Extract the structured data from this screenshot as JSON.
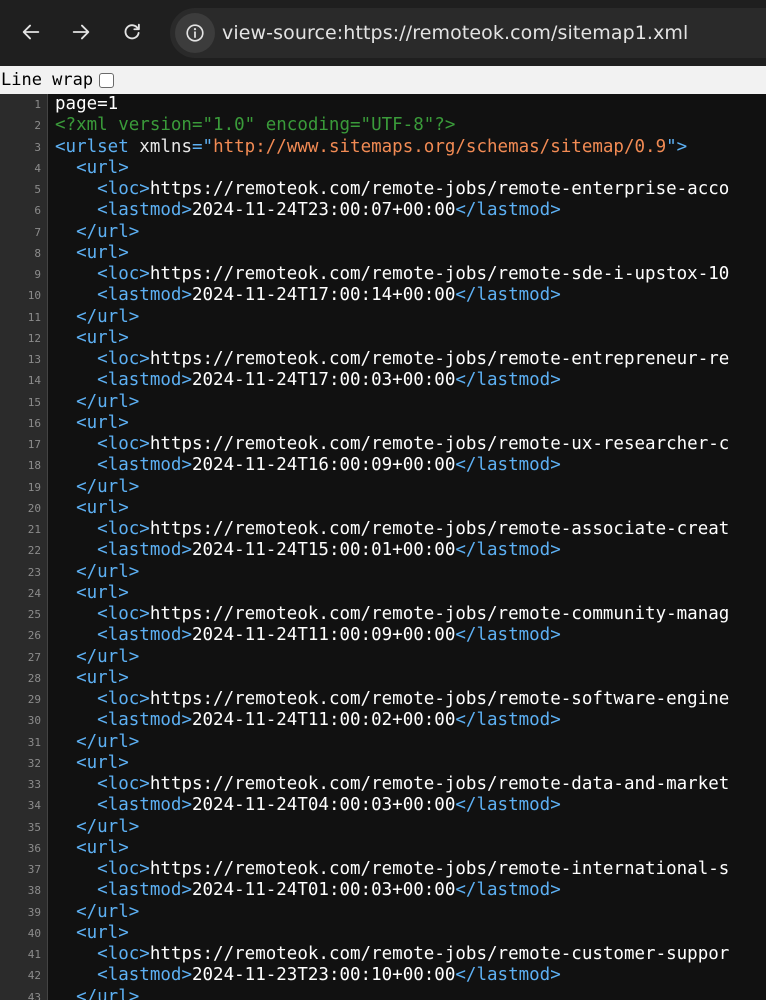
{
  "browser": {
    "url": "view-source:https://remoteok.com/sitemap1.xml",
    "icons": {
      "back": "arrow-left-icon",
      "forward": "arrow-right-icon",
      "reload": "reload-icon",
      "site_info": "info-icon"
    }
  },
  "wrapbar": {
    "label": "Line wrap",
    "checked": false
  },
  "colors": {
    "tag": "#5db0f3",
    "processing_instruction": "#3a9b3a",
    "attribute_value": "#f28b54",
    "text": "#ffffff",
    "gutter_bg": "#2b2b2b",
    "editor_bg": "#111111"
  },
  "source": {
    "lines": [
      {
        "n": "1",
        "indent": "",
        "parts": [
          {
            "c": "txt",
            "t": "page=1"
          }
        ]
      },
      {
        "n": "2",
        "indent": "",
        "parts": [
          {
            "c": "pi",
            "t": "<?xml version=\"1.0\" encoding=\"UTF-8\"?>"
          }
        ]
      },
      {
        "n": "3",
        "indent": "",
        "parts": [
          {
            "c": "tag",
            "t": "<urlset "
          },
          {
            "c": "attr",
            "t": "xmlns"
          },
          {
            "c": "tag",
            "t": "=\""
          },
          {
            "c": "aval",
            "t": "http://www.sitemaps.org/schemas/sitemap/0.9"
          },
          {
            "c": "tag",
            "t": "\">"
          }
        ]
      },
      {
        "n": "4",
        "indent": "  ",
        "parts": [
          {
            "c": "tag",
            "t": "<url>"
          }
        ]
      },
      {
        "n": "5",
        "indent": "    ",
        "parts": [
          {
            "c": "tag",
            "t": "<loc>"
          },
          {
            "c": "txt",
            "t": "https://remoteok.com/remote-jobs/remote-enterprise-acco"
          }
        ]
      },
      {
        "n": "6",
        "indent": "    ",
        "parts": [
          {
            "c": "tag",
            "t": "<lastmod>"
          },
          {
            "c": "txt",
            "t": "2024-11-24T23:00:07+00:00"
          },
          {
            "c": "tag",
            "t": "</lastmod>"
          }
        ]
      },
      {
        "n": "7",
        "indent": "  ",
        "parts": [
          {
            "c": "tag",
            "t": "</url>"
          }
        ]
      },
      {
        "n": "8",
        "indent": "  ",
        "parts": [
          {
            "c": "tag",
            "t": "<url>"
          }
        ]
      },
      {
        "n": "9",
        "indent": "    ",
        "parts": [
          {
            "c": "tag",
            "t": "<loc>"
          },
          {
            "c": "txt",
            "t": "https://remoteok.com/remote-jobs/remote-sde-i-upstox-10"
          }
        ]
      },
      {
        "n": "10",
        "indent": "    ",
        "parts": [
          {
            "c": "tag",
            "t": "<lastmod>"
          },
          {
            "c": "txt",
            "t": "2024-11-24T17:00:14+00:00"
          },
          {
            "c": "tag",
            "t": "</lastmod>"
          }
        ]
      },
      {
        "n": "11",
        "indent": "  ",
        "parts": [
          {
            "c": "tag",
            "t": "</url>"
          }
        ]
      },
      {
        "n": "12",
        "indent": "  ",
        "parts": [
          {
            "c": "tag",
            "t": "<url>"
          }
        ]
      },
      {
        "n": "13",
        "indent": "    ",
        "parts": [
          {
            "c": "tag",
            "t": "<loc>"
          },
          {
            "c": "txt",
            "t": "https://remoteok.com/remote-jobs/remote-entrepreneur-re"
          }
        ]
      },
      {
        "n": "14",
        "indent": "    ",
        "parts": [
          {
            "c": "tag",
            "t": "<lastmod>"
          },
          {
            "c": "txt",
            "t": "2024-11-24T17:00:03+00:00"
          },
          {
            "c": "tag",
            "t": "</lastmod>"
          }
        ]
      },
      {
        "n": "15",
        "indent": "  ",
        "parts": [
          {
            "c": "tag",
            "t": "</url>"
          }
        ]
      },
      {
        "n": "16",
        "indent": "  ",
        "parts": [
          {
            "c": "tag",
            "t": "<url>"
          }
        ]
      },
      {
        "n": "17",
        "indent": "    ",
        "parts": [
          {
            "c": "tag",
            "t": "<loc>"
          },
          {
            "c": "txt",
            "t": "https://remoteok.com/remote-jobs/remote-ux-researcher-c"
          }
        ]
      },
      {
        "n": "18",
        "indent": "    ",
        "parts": [
          {
            "c": "tag",
            "t": "<lastmod>"
          },
          {
            "c": "txt",
            "t": "2024-11-24T16:00:09+00:00"
          },
          {
            "c": "tag",
            "t": "</lastmod>"
          }
        ]
      },
      {
        "n": "19",
        "indent": "  ",
        "parts": [
          {
            "c": "tag",
            "t": "</url>"
          }
        ]
      },
      {
        "n": "20",
        "indent": "  ",
        "parts": [
          {
            "c": "tag",
            "t": "<url>"
          }
        ]
      },
      {
        "n": "21",
        "indent": "    ",
        "parts": [
          {
            "c": "tag",
            "t": "<loc>"
          },
          {
            "c": "txt",
            "t": "https://remoteok.com/remote-jobs/remote-associate-creat"
          }
        ]
      },
      {
        "n": "22",
        "indent": "    ",
        "parts": [
          {
            "c": "tag",
            "t": "<lastmod>"
          },
          {
            "c": "txt",
            "t": "2024-11-24T15:00:01+00:00"
          },
          {
            "c": "tag",
            "t": "</lastmod>"
          }
        ]
      },
      {
        "n": "23",
        "indent": "  ",
        "parts": [
          {
            "c": "tag",
            "t": "</url>"
          }
        ]
      },
      {
        "n": "24",
        "indent": "  ",
        "parts": [
          {
            "c": "tag",
            "t": "<url>"
          }
        ]
      },
      {
        "n": "25",
        "indent": "    ",
        "parts": [
          {
            "c": "tag",
            "t": "<loc>"
          },
          {
            "c": "txt",
            "t": "https://remoteok.com/remote-jobs/remote-community-manag"
          }
        ]
      },
      {
        "n": "26",
        "indent": "    ",
        "parts": [
          {
            "c": "tag",
            "t": "<lastmod>"
          },
          {
            "c": "txt",
            "t": "2024-11-24T11:00:09+00:00"
          },
          {
            "c": "tag",
            "t": "</lastmod>"
          }
        ]
      },
      {
        "n": "27",
        "indent": "  ",
        "parts": [
          {
            "c": "tag",
            "t": "</url>"
          }
        ]
      },
      {
        "n": "28",
        "indent": "  ",
        "parts": [
          {
            "c": "tag",
            "t": "<url>"
          }
        ]
      },
      {
        "n": "29",
        "indent": "    ",
        "parts": [
          {
            "c": "tag",
            "t": "<loc>"
          },
          {
            "c": "txt",
            "t": "https://remoteok.com/remote-jobs/remote-software-engine"
          }
        ]
      },
      {
        "n": "30",
        "indent": "    ",
        "parts": [
          {
            "c": "tag",
            "t": "<lastmod>"
          },
          {
            "c": "txt",
            "t": "2024-11-24T11:00:02+00:00"
          },
          {
            "c": "tag",
            "t": "</lastmod>"
          }
        ]
      },
      {
        "n": "31",
        "indent": "  ",
        "parts": [
          {
            "c": "tag",
            "t": "</url>"
          }
        ]
      },
      {
        "n": "32",
        "indent": "  ",
        "parts": [
          {
            "c": "tag",
            "t": "<url>"
          }
        ]
      },
      {
        "n": "33",
        "indent": "    ",
        "parts": [
          {
            "c": "tag",
            "t": "<loc>"
          },
          {
            "c": "txt",
            "t": "https://remoteok.com/remote-jobs/remote-data-and-market"
          }
        ]
      },
      {
        "n": "34",
        "indent": "    ",
        "parts": [
          {
            "c": "tag",
            "t": "<lastmod>"
          },
          {
            "c": "txt",
            "t": "2024-11-24T04:00:03+00:00"
          },
          {
            "c": "tag",
            "t": "</lastmod>"
          }
        ]
      },
      {
        "n": "35",
        "indent": "  ",
        "parts": [
          {
            "c": "tag",
            "t": "</url>"
          }
        ]
      },
      {
        "n": "36",
        "indent": "  ",
        "parts": [
          {
            "c": "tag",
            "t": "<url>"
          }
        ]
      },
      {
        "n": "37",
        "indent": "    ",
        "parts": [
          {
            "c": "tag",
            "t": "<loc>"
          },
          {
            "c": "txt",
            "t": "https://remoteok.com/remote-jobs/remote-international-s"
          }
        ]
      },
      {
        "n": "38",
        "indent": "    ",
        "parts": [
          {
            "c": "tag",
            "t": "<lastmod>"
          },
          {
            "c": "txt",
            "t": "2024-11-24T01:00:03+00:00"
          },
          {
            "c": "tag",
            "t": "</lastmod>"
          }
        ]
      },
      {
        "n": "39",
        "indent": "  ",
        "parts": [
          {
            "c": "tag",
            "t": "</url>"
          }
        ]
      },
      {
        "n": "40",
        "indent": "  ",
        "parts": [
          {
            "c": "tag",
            "t": "<url>"
          }
        ]
      },
      {
        "n": "41",
        "indent": "    ",
        "parts": [
          {
            "c": "tag",
            "t": "<loc>"
          },
          {
            "c": "txt",
            "t": "https://remoteok.com/remote-jobs/remote-customer-suppor"
          }
        ]
      },
      {
        "n": "42",
        "indent": "    ",
        "parts": [
          {
            "c": "tag",
            "t": "<lastmod>"
          },
          {
            "c": "txt",
            "t": "2024-11-23T23:00:10+00:00"
          },
          {
            "c": "tag",
            "t": "</lastmod>"
          }
        ]
      },
      {
        "n": "43",
        "indent": "  ",
        "parts": [
          {
            "c": "tag",
            "t": "</url>"
          }
        ]
      }
    ]
  }
}
